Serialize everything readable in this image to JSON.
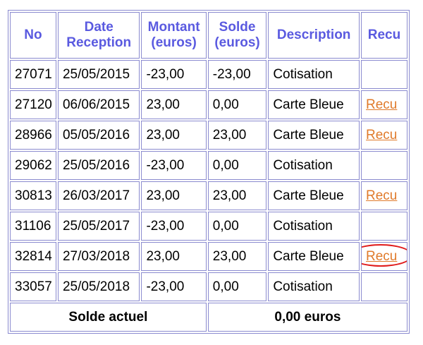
{
  "headers": {
    "no": "No",
    "date_line1": "Date",
    "date_line2": "Reception",
    "montant_line1": "Montant",
    "montant_line2": "(euros)",
    "solde_line1": "Solde",
    "solde_line2": "(euros)",
    "description": "Description",
    "recu": "Recu"
  },
  "rows": [
    {
      "no": "27071",
      "date": "25/05/2015",
      "montant": "-23,00",
      "solde": "-23,00",
      "description": "Cotisation",
      "recu": ""
    },
    {
      "no": "27120",
      "date": "06/06/2015",
      "montant": "23,00",
      "solde": "0,00",
      "description": "Carte Bleue",
      "recu": "Recu"
    },
    {
      "no": "28966",
      "date": "05/05/2016",
      "montant": "23,00",
      "solde": "23,00",
      "description": "Carte Bleue",
      "recu": "Recu"
    },
    {
      "no": "29062",
      "date": "25/05/2016",
      "montant": "-23,00",
      "solde": "0,00",
      "description": "Cotisation",
      "recu": ""
    },
    {
      "no": "30813",
      "date": "26/03/2017",
      "montant": "23,00",
      "solde": "23,00",
      "description": "Carte Bleue",
      "recu": "Recu"
    },
    {
      "no": "31106",
      "date": "25/05/2017",
      "montant": "-23,00",
      "solde": "0,00",
      "description": "Cotisation",
      "recu": ""
    },
    {
      "no": "32814",
      "date": "27/03/2018",
      "montant": "23,00",
      "solde": "23,00",
      "description": "Carte Bleue",
      "recu": "Recu"
    },
    {
      "no": "33057",
      "date": "25/05/2018",
      "montant": "-23,00",
      "solde": "0,00",
      "description": "Cotisation",
      "recu": ""
    }
  ],
  "footer": {
    "label": "Solde actuel",
    "value": "0,00 euros"
  },
  "colors": {
    "header_text": "#5a5ae0",
    "border": "#8a8acf",
    "link": "#e07a2b",
    "highlight_circle": "#e01b1b"
  },
  "highlighted_row": 6
}
